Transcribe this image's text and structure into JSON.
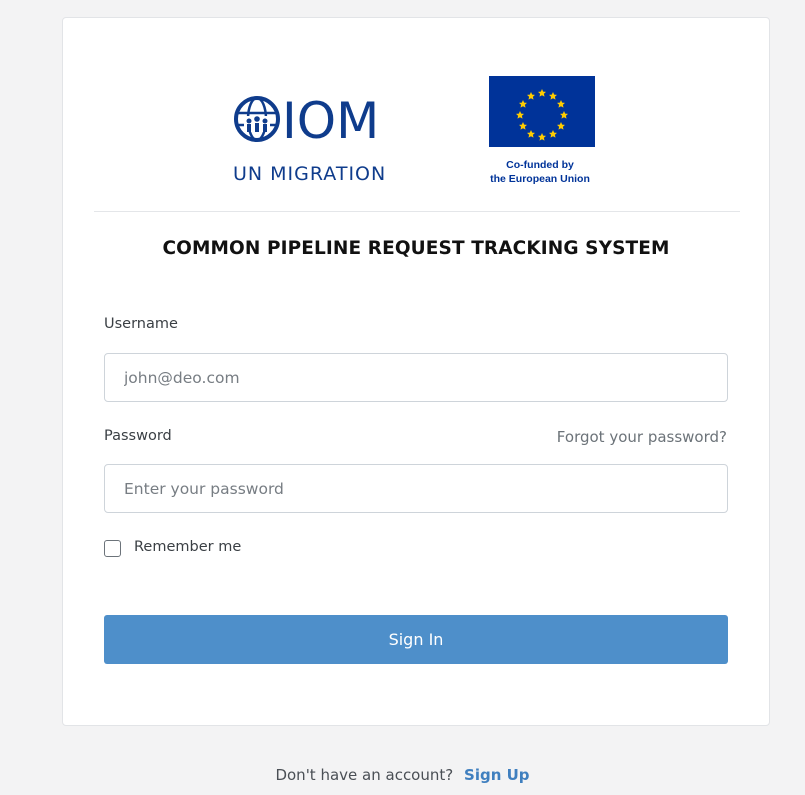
{
  "branding": {
    "iom_wordmark": "IOM",
    "iom_tagline": "UN MIGRATION",
    "eu_caption_line1": "Co-funded by",
    "eu_caption_line2": "the European Union"
  },
  "header": {
    "system_title": "COMMON PIPELINE REQUEST TRACKING SYSTEM"
  },
  "form": {
    "username_label": "Username",
    "username_placeholder": "john@deo.com",
    "username_value": "",
    "password_label": "Password",
    "forgot_password": "Forgot your password?",
    "password_placeholder": "Enter your password",
    "password_value": "",
    "remember_label": "Remember me",
    "remember_checked": false,
    "signin_label": "Sign In"
  },
  "footer": {
    "prompt": "Don't have an account?",
    "signup_link": "Sign Up"
  },
  "colors": {
    "page_background": "#f3f3f4",
    "primary_button": "#4e8fca",
    "iom_blue": "#0f3c8c",
    "eu_blue": "#003399",
    "eu_gold": "#ffcc00",
    "link": "#3f7fbf"
  }
}
